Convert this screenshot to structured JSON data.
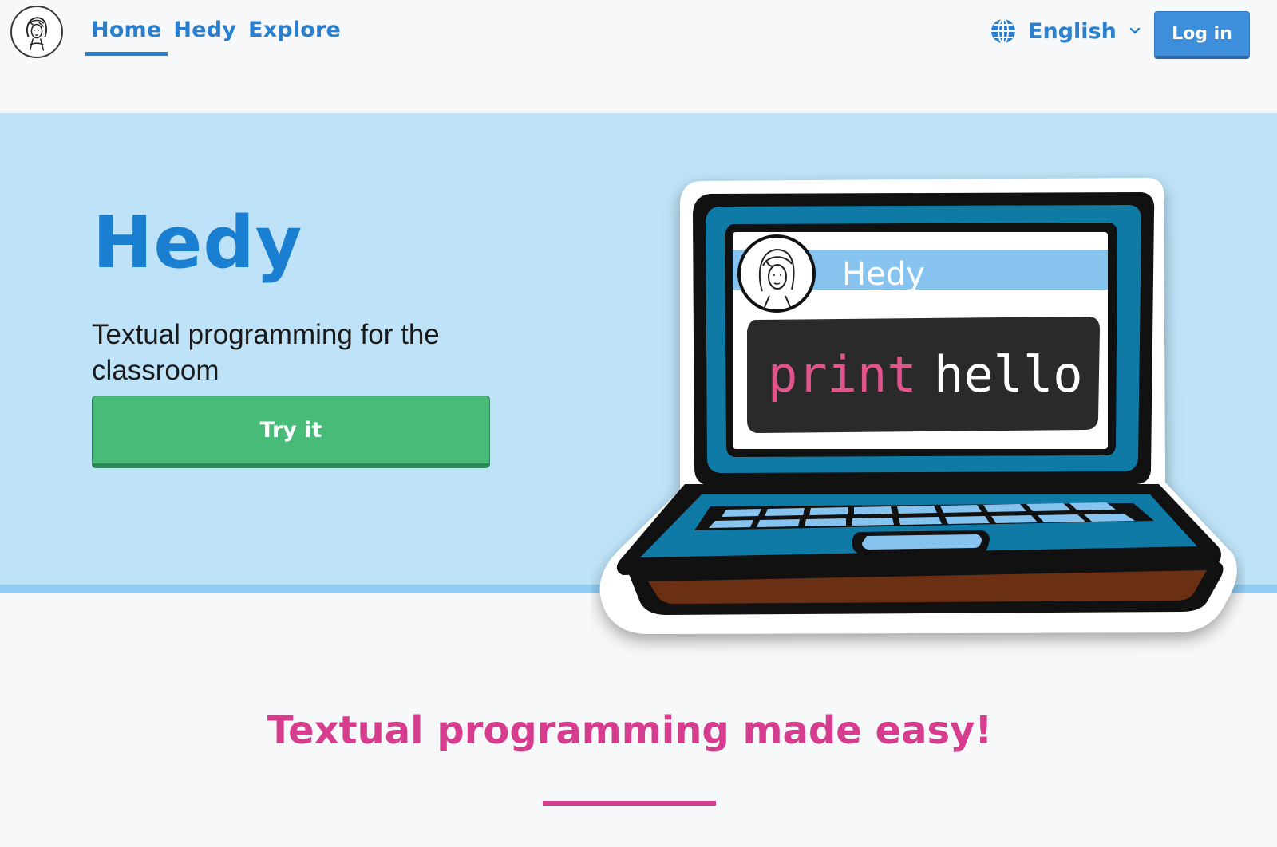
{
  "nav": {
    "logo_icon": "hedy-portrait-icon",
    "links": [
      {
        "label": "Home",
        "active": true
      },
      {
        "label": "Hedy",
        "active": false
      },
      {
        "label": "Explore",
        "active": false
      }
    ],
    "language": {
      "icon": "globe-icon",
      "label": "English",
      "chevron": "chevron-down-icon"
    },
    "login_label": "Log in"
  },
  "hero": {
    "title": "Hedy",
    "subtitle": "Textual programming for the classroom",
    "cta_label": "Try it",
    "illustration": {
      "icon": "laptop-illustration",
      "window_title": "Hedy",
      "code_keyword": "print",
      "code_argument": "hello"
    }
  },
  "section": {
    "heading": "Textual programming made easy!"
  },
  "colors": {
    "nav_link": "#2a7fcf",
    "login_bg": "#3d8fdc",
    "hero_bg": "#bee3f8",
    "hero_title": "#1a7fd0",
    "cta_bg": "#48bb78",
    "tagline": "#d63d8e",
    "code_keyword": "#e0568c"
  }
}
